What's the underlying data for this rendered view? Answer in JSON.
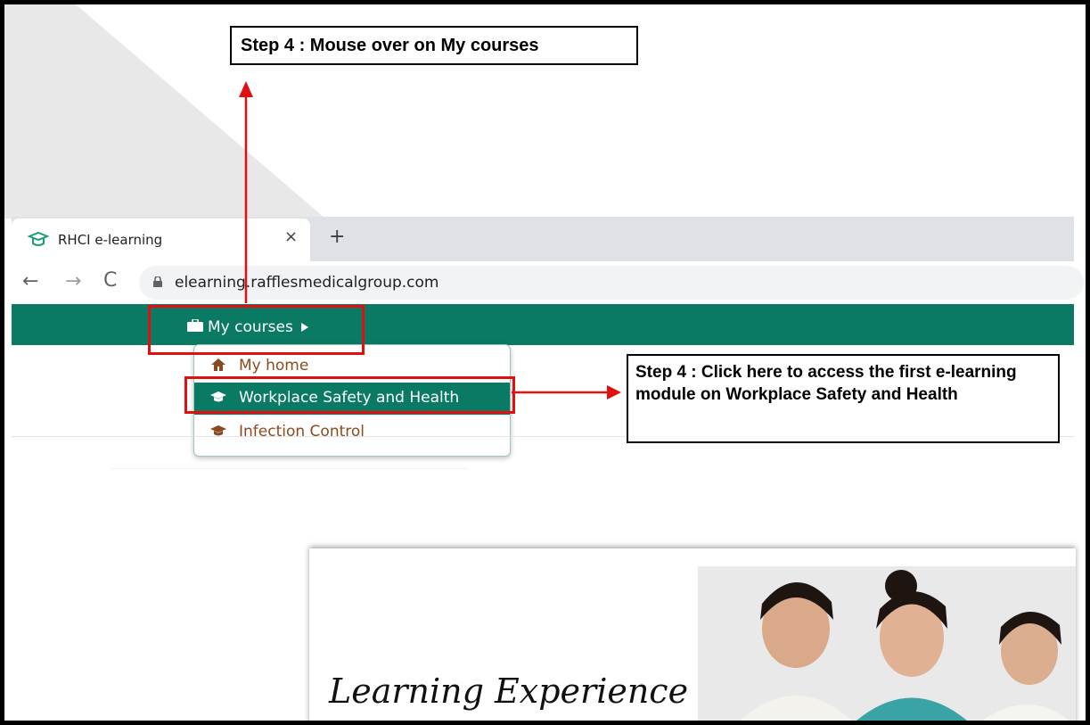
{
  "callouts": {
    "top": "Step 4 : Mouse over on My courses",
    "right": "Step 4 : Click here to access the first e-learning module on Workplace Safety and Health"
  },
  "browser": {
    "tab_title": "RHCI e-learning",
    "tab_close": "×",
    "new_tab": "+",
    "back": "←",
    "forward": "→",
    "reload": "C",
    "url": "elearning.rafflesmedicalgroup.com"
  },
  "site": {
    "menu_label": "My courses",
    "menu_items": [
      {
        "label": "My home",
        "icon": "home-icon"
      },
      {
        "label": "Workplace Safety and Health",
        "icon": "graduation-cap-icon",
        "active": true
      },
      {
        "label": "Infection Control",
        "icon": "graduation-cap-icon"
      }
    ],
    "banner_text": "Learning Experience"
  },
  "colors": {
    "navbar": "#0a7a64",
    "annotation_red": "#e01010",
    "menu_text": "#8a4a1f"
  }
}
